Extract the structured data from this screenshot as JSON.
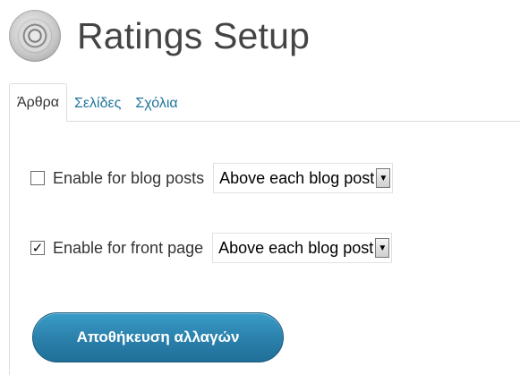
{
  "header": {
    "title": "Ratings Setup",
    "logo_icon": "ratings-logo-icon"
  },
  "tabs": [
    {
      "label": "Άρθρα",
      "active": true
    },
    {
      "label": "Σελίδες",
      "active": false
    },
    {
      "label": "Σχόλια",
      "active": false
    }
  ],
  "settings": {
    "blog_posts": {
      "checked": false,
      "check_glyph": "",
      "label": "Enable for blog posts",
      "select_value": "Above each blog post"
    },
    "front_page": {
      "checked": true,
      "check_glyph": "✓",
      "label": "Enable for front page",
      "select_value": "Above each blog post"
    }
  },
  "save_button": {
    "label": "Αποθήκευση αλλαγών"
  },
  "colors": {
    "link": "#21759b",
    "button": "#2b82ad",
    "title": "#444444"
  }
}
